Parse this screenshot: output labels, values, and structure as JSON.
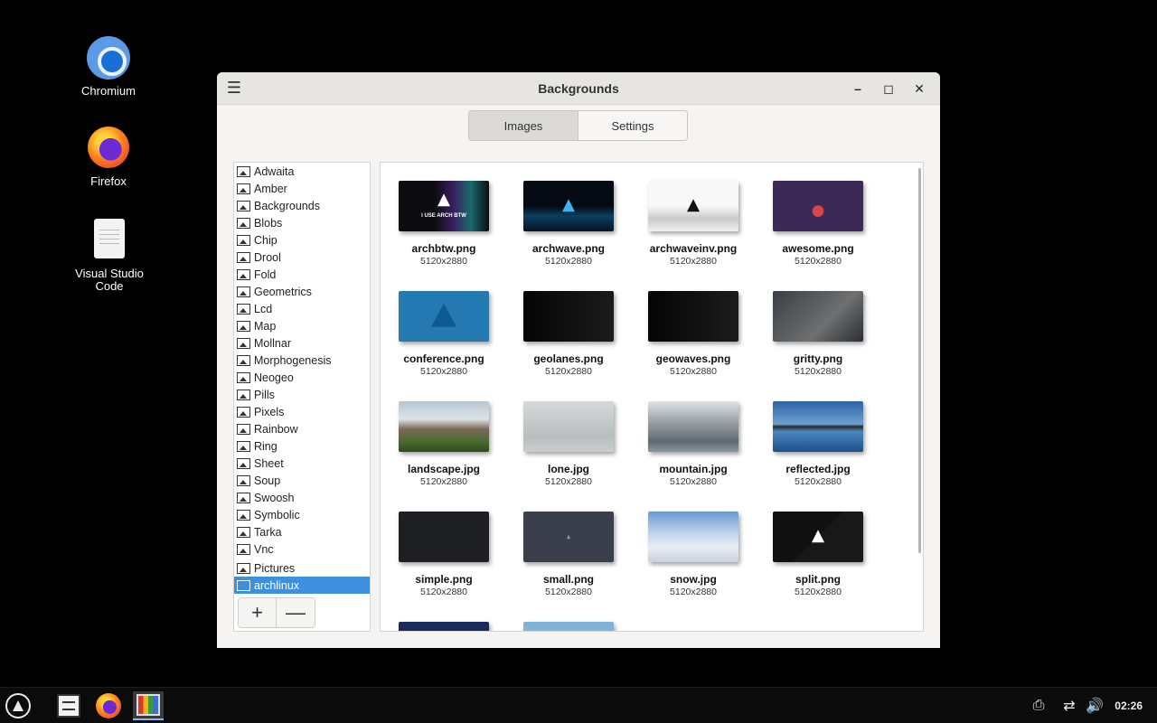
{
  "desktop": {
    "icons": [
      {
        "label": "Chromium"
      },
      {
        "label": "Firefox"
      },
      {
        "label": "Visual Studio Code"
      }
    ]
  },
  "window": {
    "title": "Backgrounds",
    "controls": {
      "minimize": "–",
      "maximize": "◻",
      "close": "✕"
    },
    "menu_icon": "☰",
    "tabs": [
      {
        "label": "Images",
        "active": true
      },
      {
        "label": "Settings",
        "active": false
      }
    ]
  },
  "sidebar": {
    "items": [
      {
        "label": "Adwaita"
      },
      {
        "label": "Amber"
      },
      {
        "label": "Backgrounds"
      },
      {
        "label": "Blobs"
      },
      {
        "label": "Chip"
      },
      {
        "label": "Drool"
      },
      {
        "label": "Fold"
      },
      {
        "label": "Geometrics"
      },
      {
        "label": "Lcd"
      },
      {
        "label": "Map"
      },
      {
        "label": "Mollnar"
      },
      {
        "label": "Morphogenesis"
      },
      {
        "label": "Neogeo"
      },
      {
        "label": "Pills"
      },
      {
        "label": "Pixels"
      },
      {
        "label": "Rainbow"
      },
      {
        "label": "Ring"
      },
      {
        "label": "Sheet"
      },
      {
        "label": "Soup"
      },
      {
        "label": "Swoosh"
      },
      {
        "label": "Symbolic"
      },
      {
        "label": "Tarka"
      },
      {
        "label": "Vnc"
      },
      {
        "label": "Pictures"
      },
      {
        "label": "archlinux",
        "selected": true
      }
    ],
    "add_button": "+",
    "remove_button": "—"
  },
  "grid": {
    "images": [
      {
        "name": "archbtw.png",
        "size": "5120x2880",
        "overlay": "I USE ARCH BTW"
      },
      {
        "name": "archwave.png",
        "size": "5120x2880"
      },
      {
        "name": "archwaveinv.png",
        "size": "5120x2880"
      },
      {
        "name": "awesome.png",
        "size": "5120x2880"
      },
      {
        "name": "conference.png",
        "size": "5120x2880"
      },
      {
        "name": "geolanes.png",
        "size": "5120x2880"
      },
      {
        "name": "geowaves.png",
        "size": "5120x2880"
      },
      {
        "name": "gritty.png",
        "size": "5120x2880"
      },
      {
        "name": "landscape.jpg",
        "size": "5120x2880"
      },
      {
        "name": "lone.jpg",
        "size": "5120x2880"
      },
      {
        "name": "mountain.jpg",
        "size": "5120x2880"
      },
      {
        "name": "reflected.jpg",
        "size": "5120x2880"
      },
      {
        "name": "simple.png",
        "size": "5120x2880"
      },
      {
        "name": "small.png",
        "size": "5120x2880"
      },
      {
        "name": "snow.jpg",
        "size": "5120x2880"
      },
      {
        "name": "split.png",
        "size": "5120x2880"
      }
    ]
  },
  "taskbar": {
    "tray_icons": [
      "printer-icon",
      "network-icon",
      "volume-icon"
    ],
    "clock": "02:26"
  }
}
